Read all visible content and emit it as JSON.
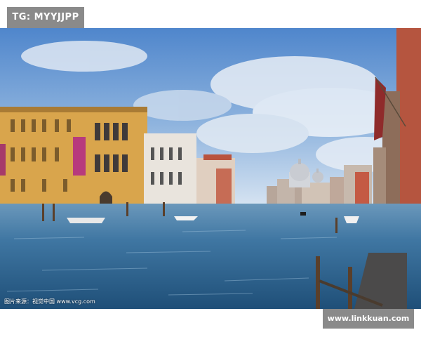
{
  "watermark_top": "TG: MYYJJPP",
  "photo_credit": "图片来源：视觉中国 www.vcg.com",
  "site_url": "www.linkkuan.com",
  "scene": {
    "sky_top": "#4f86cc",
    "sky_horizon": "#d4e2f1",
    "water_deep": "#1f4f78",
    "water_light": "#4f86ad",
    "left_palace": "#d9a54c",
    "right_wall": "#b5553f",
    "dome": "#c9ccd2"
  }
}
